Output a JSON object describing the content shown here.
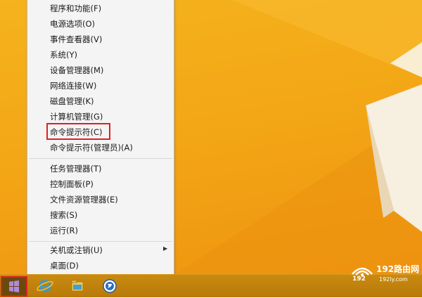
{
  "context_menu": {
    "items": [
      {
        "label": "程序和功能(F)"
      },
      {
        "label": "电源选项(O)"
      },
      {
        "label": "事件查看器(V)"
      },
      {
        "label": "系统(Y)"
      },
      {
        "label": "设备管理器(M)"
      },
      {
        "label": "网络连接(W)"
      },
      {
        "label": "磁盘管理(K)"
      },
      {
        "label": "计算机管理(G)"
      },
      {
        "label": "命令提示符(C)"
      },
      {
        "label": "命令提示符(管理员)(A)"
      },
      {
        "label": "任务管理器(T)"
      },
      {
        "label": "控制面板(P)"
      },
      {
        "label": "文件资源管理器(E)"
      },
      {
        "label": "搜索(S)"
      },
      {
        "label": "运行(R)"
      },
      {
        "label": "关机或注销(U)"
      },
      {
        "label": "桌面(D)"
      }
    ],
    "highlighted_item": "命令提示符(C)"
  },
  "taskbar": {
    "icons": [
      "windows-start-icon",
      "internet-explorer-icon",
      "file-explorer-icon",
      "store-icon"
    ]
  },
  "watermark": {
    "title": "192路由网",
    "number": "192",
    "domain": "192ly.com"
  },
  "colors": {
    "desktop": "#f3a716",
    "taskbar": "#b87a0a",
    "highlight_border": "#e02020",
    "menu_bg": "#f4f4f4"
  }
}
